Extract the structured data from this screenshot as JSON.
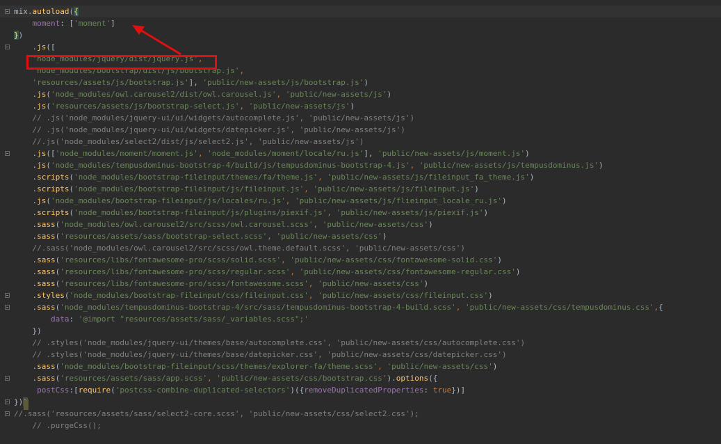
{
  "colors": {
    "background": "#2b2b2b",
    "string": "#6a8759",
    "keyword": "#cc7832",
    "method": "#ffc66d",
    "property": "#9876aa",
    "comment": "#808080",
    "highlight_box": "#e01010",
    "arrow": "#e01010"
  },
  "icons": [
    "fold-marker-icon",
    "red-arrow-annotation"
  ],
  "lines": [
    [
      [
        "b",
        "mix."
      ],
      [
        "m",
        "autoload"
      ],
      [
        "b",
        "("
      ],
      [
        "bm",
        "{"
      ]
    ],
    [
      [
        "b",
        "    "
      ],
      [
        "p",
        "moment"
      ],
      [
        "b",
        ": ["
      ],
      [
        "s",
        "'moment'"
      ],
      [
        "b",
        "]"
      ]
    ],
    [
      [
        "bm",
        "}"
      ],
      [
        "b",
        ")"
      ]
    ],
    [
      [
        "b",
        "    ."
      ],
      [
        "m",
        "js"
      ],
      [
        "b",
        "(["
      ]
    ],
    [
      [
        "b",
        "    "
      ],
      [
        "s",
        "'node_modules/jquery/dist/jquery.js'"
      ],
      [
        "k",
        ","
      ]
    ],
    [
      [
        "b",
        "    "
      ],
      [
        "s",
        "'node_modules/bootstrap/dist/js/bootstrap.js'"
      ],
      [
        "k",
        ","
      ]
    ],
    [
      [
        "b",
        "    "
      ],
      [
        "s",
        "'resources/assets/js/bootstrap.js'"
      ],
      [
        "b",
        "], "
      ],
      [
        "s",
        "'public/new-assets/js/bootstrap.js'"
      ],
      [
        "b",
        ")"
      ]
    ],
    [
      [
        "b",
        "    ."
      ],
      [
        "m",
        "js"
      ],
      [
        "b",
        "("
      ],
      [
        "s",
        "'node_modules/owl.carousel2/dist/owl.carousel.js'"
      ],
      [
        "k",
        ", "
      ],
      [
        "s",
        "'public/new-assets/js'"
      ],
      [
        "b",
        ")"
      ]
    ],
    [
      [
        "b",
        "    ."
      ],
      [
        "m",
        "js"
      ],
      [
        "b",
        "("
      ],
      [
        "s",
        "'resources/assets/js/bootstrap-select.js'"
      ],
      [
        "k",
        ", "
      ],
      [
        "s",
        "'public/new-assets/js'"
      ],
      [
        "b",
        ")"
      ]
    ],
    [
      [
        "c",
        "    // .js('node_modules/jquery-ui/ui/widgets/autocomplete.js', 'public/new-assets/js')"
      ]
    ],
    [
      [
        "c",
        "    // .js('node_modules/jquery-ui/ui/widgets/datepicker.js', 'public/new-assets/js')"
      ]
    ],
    [
      [
        "c",
        "    //.js('node_modules/select2/dist/js/select2.js', 'public/new-assets/js')"
      ]
    ],
    [
      [
        "b",
        "    ."
      ],
      [
        "m",
        "js"
      ],
      [
        "b",
        "(["
      ],
      [
        "s",
        "'node_modules/moment/moment.js'"
      ],
      [
        "k",
        ", "
      ],
      [
        "s",
        "'node_modules/moment/locale/ru.js'"
      ],
      [
        "b",
        "], "
      ],
      [
        "s",
        "'public/new-assets/js/moment.js'"
      ],
      [
        "b",
        ")"
      ]
    ],
    [
      [
        "b",
        "    ."
      ],
      [
        "m",
        "js"
      ],
      [
        "b",
        "("
      ],
      [
        "s",
        "'node_modules/tempusdominus-bootstrap-4/build/js/tempusdominus-bootstrap-4.js'"
      ],
      [
        "k",
        ", "
      ],
      [
        "s",
        "'public/new-assets/js/tempusdominus.js'"
      ],
      [
        "b",
        ")"
      ]
    ],
    [
      [
        "b",
        "    ."
      ],
      [
        "m",
        "scripts"
      ],
      [
        "b",
        "("
      ],
      [
        "s",
        "'node_modules/bootstrap-fileinput/themes/fa/theme.js'"
      ],
      [
        "k",
        ", "
      ],
      [
        "s",
        "'public/new-assets/js/fileinput_fa_theme.js'"
      ],
      [
        "b",
        ")"
      ]
    ],
    [
      [
        "b",
        "    ."
      ],
      [
        "m",
        "scripts"
      ],
      [
        "b",
        "("
      ],
      [
        "s",
        "'node_modules/bootstrap-fileinput/js/fileinput.js'"
      ],
      [
        "k",
        ", "
      ],
      [
        "s",
        "'public/new-assets/js/fileinput.js'"
      ],
      [
        "b",
        ")"
      ]
    ],
    [
      [
        "b",
        "    ."
      ],
      [
        "m",
        "js"
      ],
      [
        "b",
        "("
      ],
      [
        "s",
        "'node_modules/bootstrap-fileinput/js/locales/ru.js'"
      ],
      [
        "k",
        ", "
      ],
      [
        "s",
        "'public/new-assets/js/flieinput_locale_ru.js'"
      ],
      [
        "b",
        ")"
      ]
    ],
    [
      [
        "b",
        "    ."
      ],
      [
        "m",
        "scripts"
      ],
      [
        "b",
        "("
      ],
      [
        "s",
        "'node_modules/bootstrap-fileinput/js/plugins/piexif.js'"
      ],
      [
        "k",
        ", "
      ],
      [
        "s",
        "'public/new-assets/js/piexif.js'"
      ],
      [
        "b",
        ")"
      ]
    ],
    [
      [
        "b",
        "    ."
      ],
      [
        "m",
        "sass"
      ],
      [
        "b",
        "("
      ],
      [
        "s",
        "'node_modules/owl.carousel2/src/scss/owl.carousel.scss'"
      ],
      [
        "k",
        ", "
      ],
      [
        "s",
        "'public/new-assets/css'"
      ],
      [
        "b",
        ")"
      ]
    ],
    [
      [
        "b",
        "    ."
      ],
      [
        "m",
        "sass"
      ],
      [
        "b",
        "("
      ],
      [
        "s",
        "'resources/assets/sass/bootstrap-select.scss'"
      ],
      [
        "k",
        ", "
      ],
      [
        "s",
        "'public/new-assets/css'"
      ],
      [
        "b",
        ")"
      ]
    ],
    [
      [
        "c",
        "    //.sass('node_modules/owl.carousel2/src/scss/owl.theme.default.scss', 'public/new-assets/css')"
      ]
    ],
    [
      [
        "b",
        "    ."
      ],
      [
        "m",
        "sass"
      ],
      [
        "b",
        "("
      ],
      [
        "s",
        "'resources/libs/fontawesome-pro/scss/solid.scss'"
      ],
      [
        "k",
        ", "
      ],
      [
        "s",
        "'public/new-assets/css/fontawesome-solid.css'"
      ],
      [
        "b",
        ")"
      ]
    ],
    [
      [
        "b",
        "    ."
      ],
      [
        "m",
        "sass"
      ],
      [
        "b",
        "("
      ],
      [
        "s",
        "'resources/libs/fontawesome-pro/scss/regular.scss'"
      ],
      [
        "k",
        ", "
      ],
      [
        "s",
        "'public/new-assets/css/fontawesome-regular.css'"
      ],
      [
        "b",
        ")"
      ]
    ],
    [
      [
        "b",
        "    ."
      ],
      [
        "m",
        "sass"
      ],
      [
        "b",
        "("
      ],
      [
        "s",
        "'resources/libs/fontawesome-pro/scss/fontawesome.scss'"
      ],
      [
        "k",
        ", "
      ],
      [
        "s",
        "'public/new-assets/css'"
      ],
      [
        "b",
        ")"
      ]
    ],
    [
      [
        "b",
        "    ."
      ],
      [
        "m",
        "styles"
      ],
      [
        "b",
        "("
      ],
      [
        "s",
        "'node_modules/bootstrap-fileinput/css/fileinput.css'"
      ],
      [
        "k",
        ", "
      ],
      [
        "s",
        "'public/new-assets/css/fileinput.css'"
      ],
      [
        "b",
        ")"
      ]
    ],
    [
      [
        "b",
        "    ."
      ],
      [
        "m",
        "sass"
      ],
      [
        "b",
        "("
      ],
      [
        "s",
        "'node_modules/tempusdominus-bootstrap-4/src/sass/tempusdominus-bootstrap-4-build.scss'"
      ],
      [
        "k",
        ", "
      ],
      [
        "s",
        "'public/new-assets/css/tempusdominus.css'"
      ],
      [
        "k",
        ","
      ],
      [
        "b",
        "{"
      ]
    ],
    [
      [
        "b",
        "        "
      ],
      [
        "p",
        "data"
      ],
      [
        "b",
        ": "
      ],
      [
        "s",
        "'@import \"resources/assets/sass/_variables.scss\";'"
      ]
    ],
    [
      [
        "b",
        "    })"
      ]
    ],
    [
      [
        "c",
        "    // .styles('node_modules/jquery-ui/themes/base/autocomplete.css', 'public/new-assets/css/autocomplete.css')"
      ]
    ],
    [
      [
        "c",
        "    // .styles('node_modules/jquery-ui/themes/base/datepicker.css', 'public/new-assets/css/datepicker.css')"
      ]
    ],
    [
      [
        "b",
        "    ."
      ],
      [
        "m",
        "sass"
      ],
      [
        "b",
        "("
      ],
      [
        "s",
        "'node_modules/bootstrap-fileinput/scss/themes/explorer-fa/theme.scss'"
      ],
      [
        "k",
        ", "
      ],
      [
        "s",
        "'public/new-assets/css'"
      ],
      [
        "b",
        ")"
      ]
    ],
    [
      [
        "b",
        "    ."
      ],
      [
        "m",
        "sass"
      ],
      [
        "b",
        "("
      ],
      [
        "s",
        "'resources/assets/sass/app.scss'"
      ],
      [
        "k",
        ", "
      ],
      [
        "s",
        "'public/new-assets/css/bootstrap.css'"
      ],
      [
        "b",
        ")."
      ],
      [
        "m",
        "options"
      ],
      [
        "b",
        "({"
      ]
    ],
    [
      [
        "b",
        "     "
      ],
      [
        "p",
        "postCss"
      ],
      [
        "b",
        ":["
      ],
      [
        "m",
        "require"
      ],
      [
        "b",
        "("
      ],
      [
        "s",
        "'postcss-combine-duplicated-selectors'"
      ],
      [
        "b",
        ")({"
      ],
      [
        "p",
        "removeDuplicatedProperties"
      ],
      [
        "b",
        ": "
      ],
      [
        "k",
        "true"
      ],
      [
        "b",
        "})]"
      ]
    ],
    [
      [
        "b",
        "})"
      ],
      [
        "bm",
        ")"
      ]
    ],
    [
      [
        "c",
        "//.sass('resources/assets/sass/select2-core.scss', 'public/new-assets/css/select2.css');"
      ]
    ],
    [
      [
        "c",
        "    // .purgeCss();"
      ]
    ]
  ]
}
